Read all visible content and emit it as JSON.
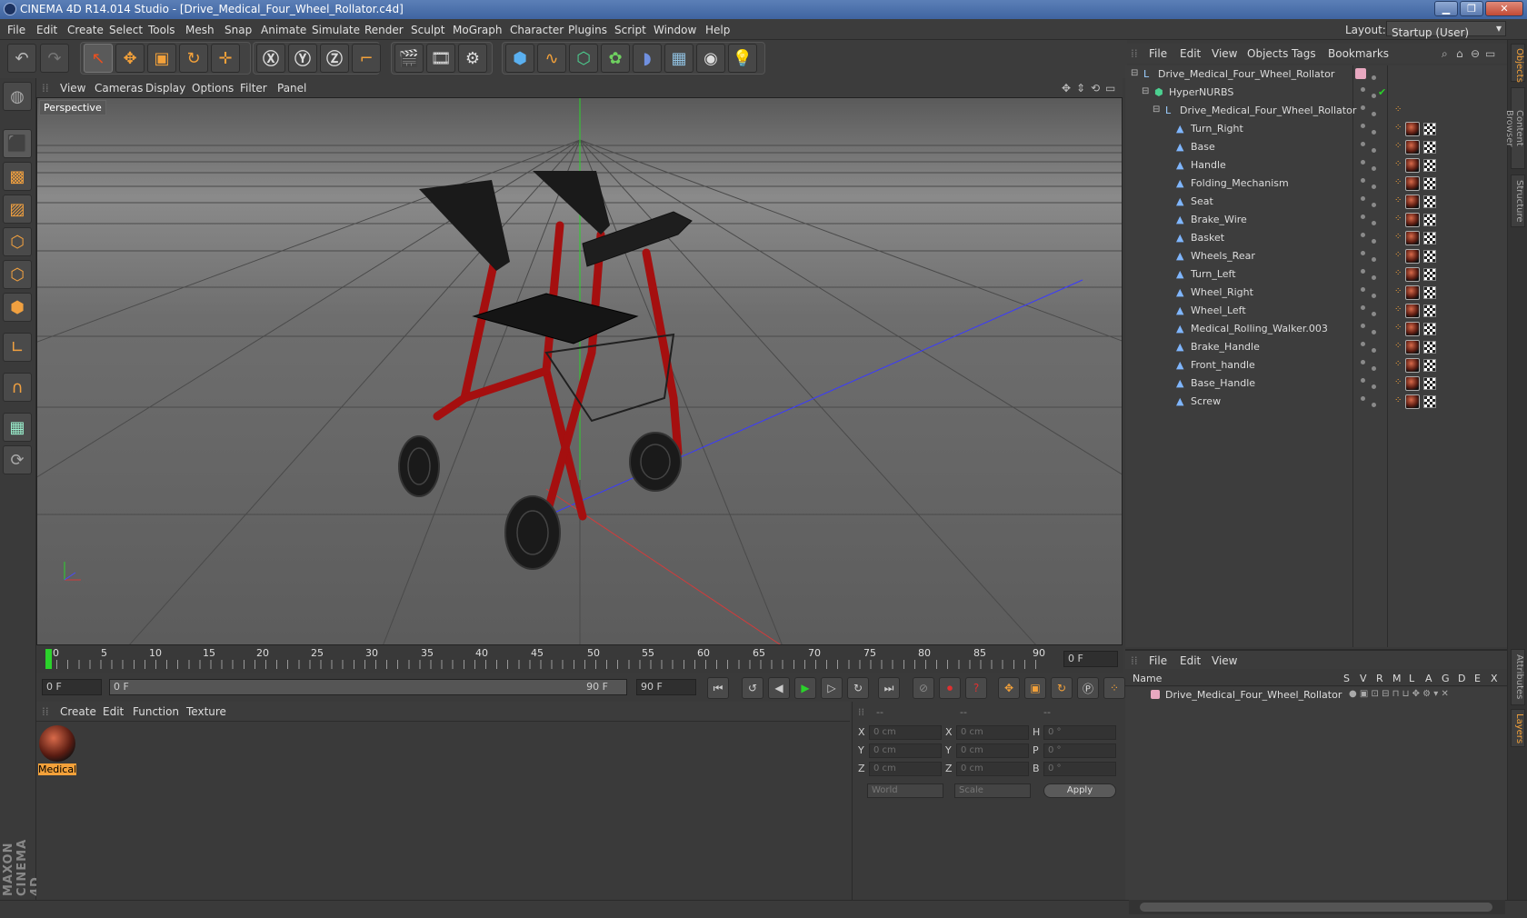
{
  "window": {
    "title": "CINEMA 4D R14.014 Studio - [Drive_Medical_Four_Wheel_Rollator.c4d]",
    "minimize": "▁",
    "restore": "❐",
    "close": "✕"
  },
  "menubar": {
    "items": [
      "File",
      "Edit",
      "Create",
      "Select",
      "Tools",
      "Mesh",
      "Snap",
      "Animate",
      "Simulate",
      "Render",
      "Sculpt",
      "MoGraph",
      "Character",
      "Plugins",
      "Script",
      "Window",
      "Help"
    ],
    "layout_label": "Layout:",
    "layout_value": "Startup (User)"
  },
  "viewport": {
    "menu": [
      "View",
      "Cameras",
      "Display",
      "Options",
      "Filter",
      "Panel"
    ],
    "label": "Perspective"
  },
  "timeline": {
    "ticks": [
      "0",
      "5",
      "10",
      "15",
      "20",
      "25",
      "30",
      "35",
      "40",
      "45",
      "50",
      "55",
      "60",
      "65",
      "70",
      "75",
      "80",
      "85",
      "90"
    ],
    "frame_field": "0 F"
  },
  "transport": {
    "start": "0 F",
    "range_start": "0 F",
    "range_end": "90 F",
    "end": "90 F"
  },
  "materials": {
    "menu": [
      "Create",
      "Edit",
      "Function",
      "Texture"
    ],
    "items": [
      {
        "name": "Medical"
      }
    ]
  },
  "coords": {
    "headers": [
      "--",
      "--",
      "--"
    ],
    "rows": [
      {
        "a": "X",
        "av": "0 cm",
        "b": "X",
        "bv": "0 cm",
        "c": "H",
        "cv": "0 °"
      },
      {
        "a": "Y",
        "av": "0 cm",
        "b": "Y",
        "bv": "0 cm",
        "c": "P",
        "cv": "0 °"
      },
      {
        "a": "Z",
        "av": "0 cm",
        "b": "Z",
        "bv": "0 cm",
        "c": "B",
        "cv": "0 °"
      }
    ],
    "world": "World",
    "scale": "Scale",
    "apply": "Apply"
  },
  "objects": {
    "menu": [
      "File",
      "Edit",
      "View",
      "Objects",
      "Tags",
      "Bookmarks"
    ],
    "tree": [
      {
        "name": "Drive_Medical_Four_Wheel_Rollator",
        "depth": 0,
        "kind": "null"
      },
      {
        "name": "HyperNURBS",
        "depth": 1,
        "kind": "hn"
      },
      {
        "name": "Drive_Medical_Four_Wheel_Rollator",
        "depth": 2,
        "kind": "null"
      },
      {
        "name": "Turn_Right",
        "depth": 3,
        "kind": "poly"
      },
      {
        "name": "Base",
        "depth": 3,
        "kind": "poly"
      },
      {
        "name": "Handle",
        "depth": 3,
        "kind": "poly"
      },
      {
        "name": "Folding_Mechanism",
        "depth": 3,
        "kind": "poly"
      },
      {
        "name": "Seat",
        "depth": 3,
        "kind": "poly"
      },
      {
        "name": "Brake_Wire",
        "depth": 3,
        "kind": "poly"
      },
      {
        "name": "Basket",
        "depth": 3,
        "kind": "poly"
      },
      {
        "name": "Wheels_Rear",
        "depth": 3,
        "kind": "poly"
      },
      {
        "name": "Turn_Left",
        "depth": 3,
        "kind": "poly"
      },
      {
        "name": "Wheel_Right",
        "depth": 3,
        "kind": "poly"
      },
      {
        "name": "Wheel_Left",
        "depth": 3,
        "kind": "poly"
      },
      {
        "name": "Medical_Rolling_Walker.003",
        "depth": 3,
        "kind": "poly"
      },
      {
        "name": "Brake_Handle",
        "depth": 3,
        "kind": "poly"
      },
      {
        "name": "Front_handle",
        "depth": 3,
        "kind": "poly"
      },
      {
        "name": "Base_Handle",
        "depth": 3,
        "kind": "poly"
      },
      {
        "name": "Screw",
        "depth": 3,
        "kind": "poly"
      }
    ]
  },
  "layers": {
    "menu": [
      "File",
      "Edit",
      "View"
    ],
    "columns": [
      "Name",
      "S",
      "V",
      "R",
      "M",
      "L",
      "A",
      "G",
      "D",
      "E",
      "X"
    ],
    "rows": [
      {
        "name": "Drive_Medical_Four_Wheel_Rollator",
        "color": "#e8a8c0"
      }
    ]
  },
  "side_tabs": [
    "Objects",
    "Content Browser",
    "Structure",
    "Attributes",
    "Layers"
  ],
  "brand": "MAXON CINEMA 4D",
  "colors": {
    "accent": "#f3a13a",
    "walker_frame": "#b01010",
    "axis_green": "#2bd22b",
    "axis_blue": "#3a3aff",
    "axis_red": "#d23b3b"
  }
}
